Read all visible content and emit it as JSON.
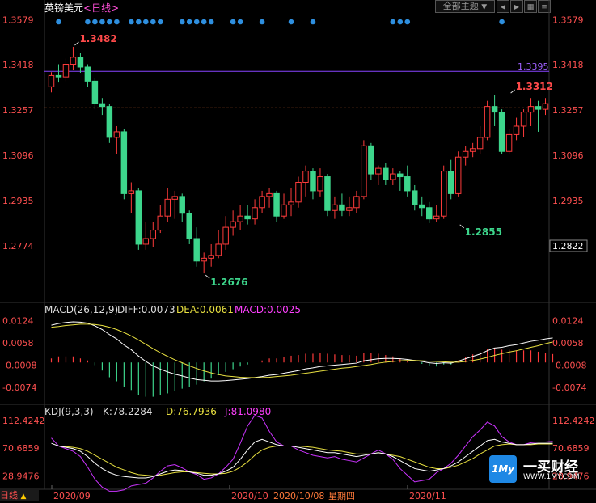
{
  "header": {
    "symbol": "英镑美元",
    "period": "<日线>",
    "theme_button": "全部主题",
    "theme_arrow": "▼",
    "nav_left": "◀",
    "nav_right": "▶"
  },
  "colors": {
    "up": "#ff3b3b",
    "down": "#3dd68c",
    "ma_line": "#8844ff",
    "dea": "#e8e040",
    "macd_text": "#ff40ff",
    "axis_label": "#ff5050",
    "diff": "#ffffff"
  },
  "chart_data": [
    {
      "type": "candlestick",
      "title": "英镑美元 日线",
      "ylim": [
        1.2613,
        1.362
      ],
      "y_ticks": [
        "1.3579",
        "1.3418",
        "1.3257",
        "1.3096",
        "1.2935",
        "1.2774"
      ],
      "x_labels": [
        "2020/09",
        "2020/10",
        "2020/11"
      ],
      "current_price": "1.2822",
      "current_price_line": 1.3265,
      "level_line": {
        "value": 1.3395,
        "label": "1.3395"
      },
      "annotations": [
        {
          "text": "1.3482",
          "index": 3,
          "value": 1.3482,
          "kind": "high"
        },
        {
          "text": "1.2676",
          "index": 21,
          "value": 1.2676,
          "kind": "low"
        },
        {
          "text": "1.2855",
          "index": 56,
          "value": 1.2855,
          "kind": "low"
        },
        {
          "text": "1.3312",
          "index": 63,
          "value": 1.3312,
          "kind": "high"
        }
      ],
      "candles": [
        [
          1.334,
          1.338,
          1.332,
          1.3392
        ],
        [
          1.338,
          1.3375,
          1.3355,
          1.342
        ],
        [
          1.3375,
          1.342,
          1.336,
          1.344
        ],
        [
          1.342,
          1.3445,
          1.34,
          1.3482
        ],
        [
          1.3445,
          1.341,
          1.339,
          1.346
        ],
        [
          1.341,
          1.336,
          1.334,
          1.342
        ],
        [
          1.336,
          1.328,
          1.326,
          1.337
        ],
        [
          1.328,
          1.327,
          1.324,
          1.33
        ],
        [
          1.327,
          1.316,
          1.314,
          1.328
        ],
        [
          1.316,
          1.318,
          1.31,
          1.32
        ],
        [
          1.318,
          1.296,
          1.294,
          1.319
        ],
        [
          1.296,
          1.297,
          1.289,
          1.3
        ],
        [
          1.297,
          1.278,
          1.276,
          1.298
        ],
        [
          1.278,
          1.28,
          1.276,
          1.286
        ],
        [
          1.28,
          1.283,
          1.277,
          1.286
        ],
        [
          1.283,
          1.288,
          1.282,
          1.292
        ],
        [
          1.288,
          1.294,
          1.286,
          1.298
        ],
        [
          1.294,
          1.295,
          1.287,
          1.297
        ],
        [
          1.295,
          1.289,
          1.286,
          1.296
        ],
        [
          1.289,
          1.28,
          1.278,
          1.29
        ],
        [
          1.28,
          1.272,
          1.27,
          1.284
        ],
        [
          1.272,
          1.273,
          1.2676,
          1.275
        ],
        [
          1.273,
          1.274,
          1.27,
          1.278
        ],
        [
          1.274,
          1.278,
          1.273,
          1.283
        ],
        [
          1.278,
          1.284,
          1.276,
          1.288
        ],
        [
          1.284,
          1.286,
          1.281,
          1.29
        ],
        [
          1.286,
          1.288,
          1.283,
          1.292
        ],
        [
          1.288,
          1.287,
          1.285,
          1.292
        ],
        [
          1.287,
          1.291,
          1.285,
          1.294
        ],
        [
          1.291,
          1.295,
          1.289,
          1.297
        ],
        [
          1.295,
          1.296,
          1.291,
          1.298
        ],
        [
          1.296,
          1.288,
          1.286,
          1.297
        ],
        [
          1.288,
          1.292,
          1.287,
          1.296
        ],
        [
          1.292,
          1.293,
          1.288,
          1.298
        ],
        [
          1.293,
          1.3,
          1.291,
          1.302
        ],
        [
          1.3,
          1.304,
          1.295,
          1.306
        ],
        [
          1.304,
          1.297,
          1.294,
          1.305
        ],
        [
          1.297,
          1.302,
          1.295,
          1.305
        ],
        [
          1.302,
          1.29,
          1.288,
          1.303
        ],
        [
          1.29,
          1.292,
          1.287,
          1.295
        ],
        [
          1.292,
          1.29,
          1.288,
          1.296
        ],
        [
          1.29,
          1.291,
          1.288,
          1.295
        ],
        [
          1.291,
          1.295,
          1.289,
          1.297
        ],
        [
          1.295,
          1.313,
          1.294,
          1.315
        ],
        [
          1.313,
          1.303,
          1.301,
          1.314
        ],
        [
          1.303,
          1.305,
          1.299,
          1.306
        ],
        [
          1.305,
          1.301,
          1.299,
          1.307
        ],
        [
          1.301,
          1.303,
          1.299,
          1.305
        ],
        [
          1.303,
          1.302,
          1.297,
          1.304
        ],
        [
          1.302,
          1.297,
          1.295,
          1.306
        ],
        [
          1.297,
          1.292,
          1.29,
          1.299
        ],
        [
          1.292,
          1.291,
          1.288,
          1.295
        ],
        [
          1.291,
          1.287,
          1.2855,
          1.293
        ],
        [
          1.287,
          1.288,
          1.286,
          1.292
        ],
        [
          1.288,
          1.304,
          1.287,
          1.306
        ],
        [
          1.304,
          1.296,
          1.294,
          1.308
        ],
        [
          1.296,
          1.309,
          1.295,
          1.311
        ],
        [
          1.309,
          1.311,
          1.306,
          1.313
        ],
        [
          1.311,
          1.312,
          1.309,
          1.314
        ],
        [
          1.312,
          1.316,
          1.31,
          1.32
        ],
        [
          1.316,
          1.327,
          1.315,
          1.329
        ],
        [
          1.327,
          1.325,
          1.32,
          1.3312
        ],
        [
          1.325,
          1.311,
          1.31,
          1.326
        ],
        [
          1.311,
          1.317,
          1.31,
          1.319
        ],
        [
          1.317,
          1.32,
          1.315,
          1.323
        ],
        [
          1.32,
          1.325,
          1.316,
          1.326
        ],
        [
          1.325,
          1.327,
          1.32,
          1.33
        ],
        [
          1.327,
          1.326,
          1.318,
          1.329
        ],
        [
          1.326,
          1.328,
          1.324,
          1.33
        ]
      ]
    },
    {
      "type": "bar",
      "title": "MACD(26,12,9)",
      "ylim": [
        -0.0115,
        0.0145
      ],
      "y_ticks": [
        "0.0124",
        "0.0058",
        "-0.0008",
        "-0.0074"
      ],
      "series": [
        {
          "name": "DIFF",
          "label_value": "0.0073"
        },
        {
          "name": "DEA",
          "label_value": "0.0061"
        },
        {
          "name": "MACD",
          "label_value": "0.0025"
        }
      ],
      "diff_values": [
        0.0111,
        0.0116,
        0.0119,
        0.0121,
        0.012,
        0.0117,
        0.0109,
        0.0098,
        0.0083,
        0.007,
        0.0052,
        0.0038,
        0.0019,
        0.0003,
        -0.001,
        -0.002,
        -0.0028,
        -0.0035,
        -0.004,
        -0.0046,
        -0.0051,
        -0.0053,
        -0.0055,
        -0.0055,
        -0.0054,
        -0.0052,
        -0.005,
        -0.0048,
        -0.0045,
        -0.0042,
        -0.0038,
        -0.0036,
        -0.0032,
        -0.0028,
        -0.0024,
        -0.0019,
        -0.0016,
        -0.0012,
        -0.001,
        -0.0008,
        -0.0006,
        -0.0004,
        -0.0002,
        0.0005,
        0.0008,
        0.0011,
        0.0012,
        0.0012,
        0.0011,
        0.0009,
        0.0006,
        0.0003,
        -0.0001,
        -0.0003,
        -0.0001,
        -0.0002,
        0.0004,
        0.0011,
        0.0018,
        0.0025,
        0.0035,
        0.0043,
        0.0045,
        0.005,
        0.0053,
        0.0058,
        0.0063,
        0.0066,
        0.007,
        0.0073
      ],
      "dea_values": [
        0.0105,
        0.0107,
        0.011,
        0.0112,
        0.0114,
        0.0114,
        0.0113,
        0.011,
        0.0105,
        0.0098,
        0.0089,
        0.0079,
        0.0067,
        0.0054,
        0.0041,
        0.0029,
        0.0018,
        0.0008,
        -0.0001,
        -0.001,
        -0.0018,
        -0.0025,
        -0.0031,
        -0.0036,
        -0.004,
        -0.0042,
        -0.0044,
        -0.0045,
        -0.0045,
        -0.0045,
        -0.0044,
        -0.0042,
        -0.004,
        -0.0038,
        -0.0035,
        -0.0032,
        -0.0029,
        -0.0026,
        -0.0023,
        -0.002,
        -0.0017,
        -0.0015,
        -0.0012,
        -0.0009,
        -0.0006,
        -0.0002,
        0.0001,
        0.0003,
        0.0005,
        0.0006,
        0.0006,
        0.0005,
        0.0004,
        0.0003,
        0.0002,
        0.0001,
        0.0001,
        0.0003,
        0.0006,
        0.001,
        0.0015,
        0.0021,
        0.0026,
        0.0031,
        0.0035,
        0.004,
        0.0045,
        0.005,
        0.0056,
        0.0061
      ],
      "macd_values": [
        0.0012,
        0.0018,
        0.0018,
        0.0018,
        0.0012,
        0.0006,
        -0.0008,
        -0.0024,
        -0.0044,
        -0.0056,
        -0.0074,
        -0.0082,
        -0.0096,
        -0.0102,
        -0.0102,
        -0.0098,
        -0.0092,
        -0.0086,
        -0.0078,
        -0.0072,
        -0.0066,
        -0.0056,
        -0.0048,
        -0.0038,
        -0.0028,
        -0.002,
        -0.0012,
        -0.0006,
        0.0,
        0.0006,
        0.0012,
        0.0012,
        0.0016,
        0.002,
        0.0022,
        0.0026,
        0.0026,
        0.0028,
        0.0026,
        0.0024,
        0.0022,
        0.0022,
        0.002,
        0.0028,
        0.0028,
        0.0026,
        0.0022,
        0.0018,
        0.0012,
        0.0006,
        0.0,
        -0.0004,
        -0.001,
        -0.0012,
        -0.0006,
        -0.0006,
        0.0006,
        0.0016,
        0.0024,
        0.003,
        0.004,
        0.0044,
        0.0038,
        0.0038,
        0.0036,
        0.0036,
        0.0036,
        0.0032,
        0.0028,
        0.0025
      ]
    },
    {
      "type": "line",
      "title": "KDJ(9,3,3)",
      "ylim": [
        15,
        122
      ],
      "y_ticks": [
        "112.4242",
        "70.6859",
        "28.9476"
      ],
      "series": [
        {
          "name": "K",
          "label_value": "78.2284"
        },
        {
          "name": "D",
          "label_value": "76.7936"
        },
        {
          "name": "J",
          "label_value": "81.0980"
        }
      ],
      "k_values": [
        78,
        74,
        72,
        70,
        66,
        58,
        48,
        40,
        34,
        30,
        28,
        27,
        26,
        26,
        28,
        32,
        36,
        38,
        37,
        35,
        33,
        30,
        30,
        32,
        36,
        42,
        54,
        68,
        80,
        84,
        80,
        76,
        74,
        74,
        72,
        70,
        68,
        66,
        64,
        64,
        62,
        60,
        58,
        60,
        62,
        64,
        62,
        58,
        52,
        46,
        40,
        38,
        36,
        38,
        40,
        44,
        50,
        58,
        66,
        74,
        82,
        84,
        80,
        78,
        76,
        76,
        77,
        78,
        78,
        78
      ],
      "d_values": [
        74,
        74,
        73,
        72,
        70,
        66,
        60,
        54,
        48,
        42,
        38,
        34,
        31,
        30,
        29,
        30,
        32,
        34,
        35,
        35,
        34,
        33,
        32,
        32,
        33,
        36,
        42,
        50,
        60,
        68,
        72,
        74,
        74,
        74,
        74,
        73,
        72,
        70,
        68,
        67,
        66,
        64,
        62,
        62,
        62,
        62,
        62,
        60,
        58,
        54,
        50,
        46,
        42,
        40,
        40,
        42,
        45,
        50,
        55,
        62,
        68,
        74,
        76,
        77,
        76,
        76,
        76,
        77,
        77,
        77
      ],
      "j_values": [
        86,
        74,
        70,
        66,
        58,
        42,
        24,
        12,
        6,
        6,
        8,
        14,
        16,
        18,
        26,
        36,
        44,
        46,
        41,
        35,
        31,
        24,
        26,
        32,
        42,
        54,
        78,
        104,
        120,
        116,
        96,
        80,
        74,
        74,
        68,
        64,
        60,
        58,
        56,
        58,
        54,
        52,
        50,
        56,
        62,
        68,
        62,
        54,
        40,
        30,
        20,
        22,
        24,
        34,
        40,
        48,
        60,
        74,
        88,
        98,
        110,
        104,
        88,
        80,
        76,
        76,
        79,
        80,
        80,
        81
      ]
    }
  ],
  "bottom_bar": {
    "period_tab": "日线",
    "up_arrow": "▲",
    "date_labels": [
      "2020/09",
      "2020/10",
      "2020/11"
    ],
    "cursor_date": "2020/10/08",
    "cursor_weekday": "星期四"
  },
  "brand": {
    "logo_mark": "1My",
    "name": "一买财经",
    "url": "WWW.1MY.COM"
  }
}
